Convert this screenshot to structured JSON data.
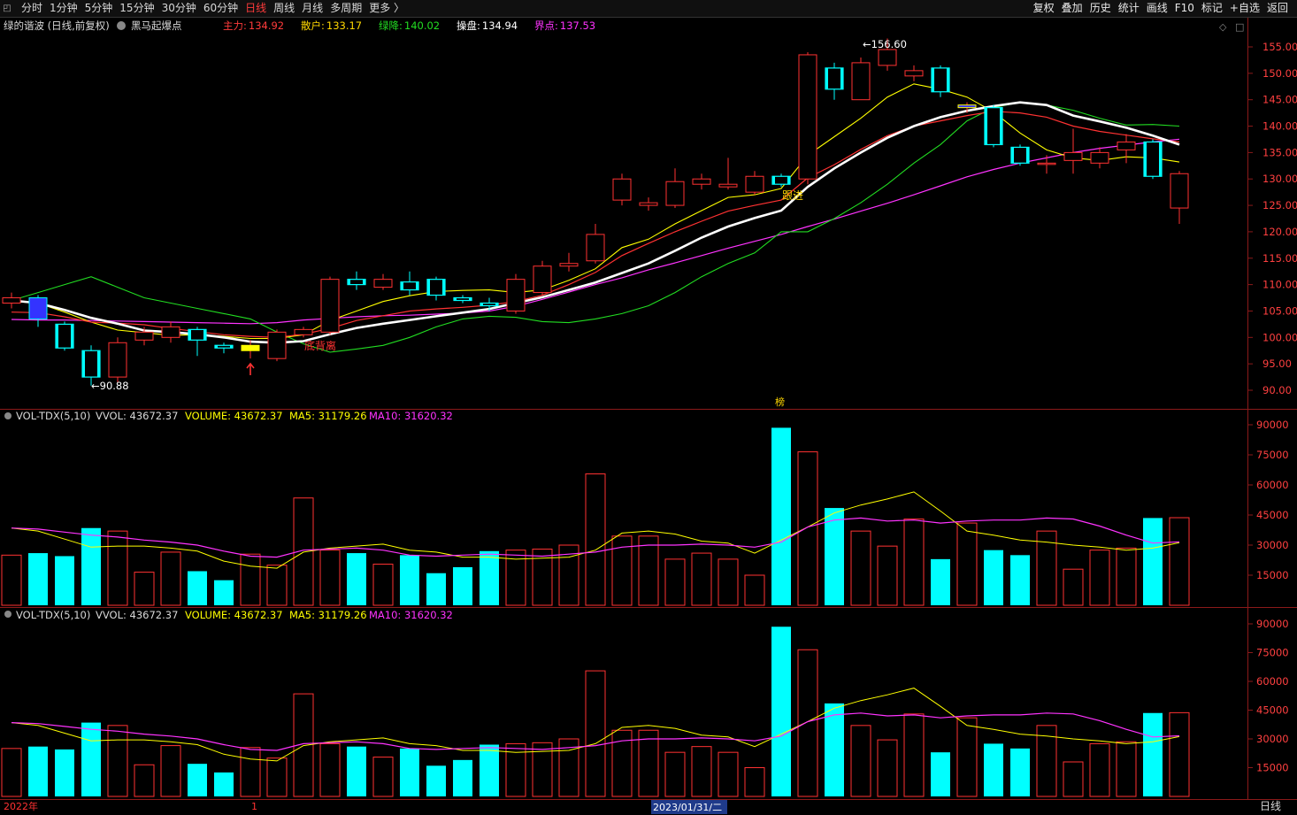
{
  "toolbar": {
    "periods": [
      "分时",
      "1分钟",
      "5分钟",
      "15分钟",
      "30分钟",
      "60分钟",
      "日线",
      "周线",
      "月线",
      "多周期",
      "更多 〉"
    ],
    "active_index": 6,
    "right_buttons": [
      "复权",
      "叠加",
      "历史",
      "统计",
      "画线",
      "F10",
      "标记",
      "+自选",
      "返回"
    ]
  },
  "main_header": {
    "title": "绿的谐波 (日线,前复权)",
    "indicator": "黑马起爆点",
    "values": [
      {
        "label": "主力:",
        "value": "134.92",
        "color": "#ff3b3b"
      },
      {
        "label": "散户:",
        "value": "133.17",
        "color": "#ffd700"
      },
      {
        "label": "绿降:",
        "value": "140.02",
        "color": "#22dd22"
      },
      {
        "label": "操盘:",
        "value": "134.94",
        "color": "#ffffff"
      },
      {
        "label": "界点:",
        "value": "137.53",
        "color": "#ff33ff"
      }
    ]
  },
  "vol_header": {
    "name": "VOL-TDX(5,10)",
    "vvol": "VVOL: 43672.37",
    "volume": "VOLUME: 43672.37",
    "ma5": "MA5: 31179.26",
    "ma10": "MA10: 31620.32"
  },
  "colors": {
    "up": "#ff3232",
    "down": "#00ffff",
    "ma_white": "#ffffff",
    "ma_red": "#ff3232",
    "ma_yellow": "#ffff00",
    "ma_green": "#22dd22",
    "ma_magenta": "#ff33ff"
  },
  "annotations": {
    "high": "156.60",
    "low": "90.88",
    "signal1": "底背离",
    "signal2": "跟进",
    "bang": "榜"
  },
  "price_axis": [
    "155.00",
    "150.00",
    "145.00",
    "140.00",
    "135.00",
    "130.00",
    "125.00",
    "120.00",
    "115.00",
    "110.00",
    "105.00",
    "100.00",
    "95.00",
    "90.00"
  ],
  "vol_axis": [
    "90000",
    "75000",
    "60000",
    "45000",
    "30000",
    "15000"
  ],
  "bottom": {
    "year": "2022年",
    "marker": "1",
    "date": "2023/01/31/二",
    "period": "日线"
  },
  "chart_data": {
    "type": "candlestick",
    "price_ylim": [
      88,
      158
    ],
    "vol_ylim": [
      0,
      92000
    ],
    "candles": [
      [
        106.5,
        107.5,
        108.5,
        105.5
      ],
      [
        107.5,
        103.5,
        108.0,
        102.0
      ],
      [
        102.5,
        98.0,
        103.0,
        97.5
      ],
      [
        97.5,
        92.5,
        98.5,
        90.88
      ],
      [
        92.5,
        99.0,
        100.0,
        91.5
      ],
      [
        99.5,
        101.0,
        102.0,
        98.5
      ],
      [
        100.0,
        102.0,
        103.0,
        99.0
      ],
      [
        101.5,
        99.5,
        102.0,
        96.5
      ],
      [
        98.5,
        98.0,
        99.0,
        97.0
      ],
      [
        97.5,
        98.5,
        99.5,
        96.0
      ],
      [
        96.0,
        101.0,
        101.5,
        95.5
      ],
      [
        100.5,
        101.5,
        102.0,
        100.0
      ],
      [
        101.0,
        111.0,
        111.5,
        100.5
      ],
      [
        111.0,
        110.0,
        112.5,
        109.0
      ],
      [
        109.5,
        111.0,
        112.0,
        109.0
      ],
      [
        110.5,
        109.0,
        112.5,
        108.0
      ],
      [
        111.0,
        108.0,
        111.5,
        107.0
      ],
      [
        107.5,
        107.0,
        108.0,
        106.5
      ],
      [
        106.5,
        106.0,
        107.5,
        105.0
      ],
      [
        105.0,
        111.0,
        112.0,
        104.5
      ],
      [
        108.5,
        113.5,
        114.5,
        108.0
      ],
      [
        113.5,
        114.0,
        116.0,
        112.5
      ],
      [
        114.5,
        119.5,
        121.5,
        114.0
      ],
      [
        126.0,
        130.0,
        131.0,
        125.0
      ],
      [
        125.0,
        125.5,
        126.5,
        124.0
      ],
      [
        125.0,
        129.5,
        132.0,
        124.5
      ],
      [
        129.0,
        130.0,
        131.0,
        128.0
      ],
      [
        128.5,
        129.0,
        134.0,
        128.0
      ],
      [
        127.5,
        130.5,
        131.5,
        127.0
      ],
      [
        130.5,
        129.0,
        131.0,
        128.5
      ],
      [
        130.0,
        153.5,
        154.0,
        129.0
      ],
      [
        151.0,
        147.0,
        152.0,
        145.0
      ],
      [
        145.0,
        152.0,
        153.0,
        145.0
      ],
      [
        151.5,
        154.5,
        156.6,
        150.5
      ],
      [
        149.5,
        150.5,
        151.5,
        148.5
      ],
      [
        151.0,
        146.5,
        151.5,
        145.5
      ],
      [
        143.5,
        144.0,
        144.5,
        142.5
      ],
      [
        143.5,
        136.5,
        144.0,
        136.0
      ],
      [
        136.0,
        133.0,
        136.5,
        132.5
      ],
      [
        133.0,
        133.0,
        134.5,
        131.0
      ],
      [
        133.5,
        135.0,
        139.5,
        131.0
      ],
      [
        133.0,
        135.0,
        136.0,
        132.0
      ],
      [
        135.5,
        137.0,
        138.5,
        133.0
      ],
      [
        137.0,
        130.5,
        137.5,
        130.0
      ],
      [
        124.5,
        131.0,
        131.5,
        121.5
      ]
    ],
    "volume": [
      25000,
      26000,
      24500,
      38500,
      37000,
      16500,
      26500,
      17000,
      12500,
      25500,
      20000,
      53500,
      27500,
      26000,
      20500,
      25000,
      16000,
      19000,
      27000,
      27500,
      28000,
      30000,
      65500,
      34500,
      34500,
      23000,
      26000,
      23000,
      15000,
      88500,
      76500,
      48500,
      37000,
      29500,
      43000,
      23000,
      41000,
      27500,
      25000,
      37000,
      18000,
      27500,
      28500,
      43500,
      43672
    ],
    "ma_white": [
      107.0,
      106.5,
      105.2,
      103.7,
      102.6,
      101.3,
      101.0,
      100.6,
      100.0,
      99.2,
      99.0,
      99.3,
      100.6,
      101.8,
      102.6,
      103.3,
      104.0,
      104.7,
      105.4,
      106.5,
      107.6,
      109.0,
      110.4,
      112.2,
      114.0,
      116.4,
      118.9,
      121.0,
      122.6,
      124.0,
      128.5,
      132.0,
      135.0,
      137.8,
      140.0,
      141.7,
      142.9,
      143.8,
      144.5,
      144.0,
      142.0,
      140.9,
      139.7,
      138.2,
      136.5
    ],
    "ma_red": [
      104.8,
      104.7,
      103.9,
      102.9,
      102.7,
      102.4,
      101.7,
      101.1,
      100.5,
      100.2,
      100.0,
      100.6,
      101.7,
      103.2,
      104.1,
      105.0,
      105.4,
      105.7,
      106.1,
      106.8,
      108.0,
      110.0,
      112.3,
      115.5,
      117.8,
      120.0,
      122.0,
      123.9,
      125.0,
      126.0,
      130.2,
      132.7,
      135.6,
      138.2,
      140.0,
      141.0,
      142.0,
      142.8,
      142.5,
      141.7,
      140.0,
      139.0,
      138.3,
      137.6,
      137.0
    ],
    "ma_yellow": [
      106.8,
      106.5,
      104.8,
      102.9,
      101.4,
      100.9,
      100.4,
      100.5,
      100.2,
      99.8,
      99.8,
      100.5,
      103.2,
      105.0,
      106.8,
      107.9,
      108.7,
      108.9,
      109.0,
      108.5,
      109.0,
      110.8,
      113.0,
      117.0,
      118.6,
      121.5,
      124.0,
      126.5,
      127.0,
      128.2,
      134.5,
      138.0,
      141.5,
      145.5,
      148.0,
      147.0,
      145.5,
      142.7,
      138.7,
      135.5,
      134.0,
      133.5,
      134.2,
      134.0,
      133.2
    ],
    "ma_green": [
      107.0,
      108.5,
      110.0,
      111.5,
      109.5,
      107.5,
      106.5,
      105.5,
      104.5,
      103.5,
      101.0,
      98.8,
      97.2,
      97.8,
      98.5,
      100.0,
      102.0,
      103.5,
      104.0,
      103.8,
      103.0,
      102.8,
      103.5,
      104.5,
      106.0,
      108.5,
      111.5,
      114.0,
      116.0,
      120.0,
      120.0,
      122.5,
      125.5,
      129.0,
      133.0,
      136.5,
      141.0,
      143.5,
      144.5,
      144.0,
      143.0,
      141.5,
      140.2,
      140.3,
      140.0
    ],
    "ma_magenta": [
      103.4,
      103.3,
      103.3,
      103.2,
      103.1,
      103.0,
      102.9,
      102.8,
      102.7,
      102.6,
      102.8,
      103.3,
      103.6,
      103.9,
      104.1,
      104.2,
      104.4,
      104.6,
      105.0,
      105.9,
      107.2,
      108.6,
      110.0,
      111.3,
      112.8,
      114.1,
      115.5,
      116.9,
      118.2,
      119.5,
      121.0,
      122.4,
      123.9,
      125.4,
      127.0,
      128.7,
      130.4,
      131.8,
      133.0,
      134.0,
      135.0,
      135.8,
      136.4,
      137.0,
      137.53
    ],
    "vol_ma5": [
      38500,
      37000,
      33000,
      29000,
      29500,
      29500,
      28500,
      27000,
      22000,
      19500,
      18500,
      26500,
      28500,
      29500,
      30500,
      27500,
      26500,
      24000,
      24000,
      23000,
      23500,
      24000,
      27500,
      36000,
      37000,
      35500,
      32000,
      31000,
      26000,
      32500,
      39000,
      46000,
      50000,
      53000,
      56500,
      47000,
      37000,
      35000,
      32500,
      31500,
      30000,
      29000,
      27500,
      28500,
      31179
    ],
    "vol_ma10": [
      38500,
      38000,
      36500,
      35000,
      34000,
      32500,
      31500,
      30000,
      27000,
      24500,
      24000,
      27500,
      28000,
      28500,
      27500,
      25000,
      24500,
      25000,
      25500,
      25000,
      24500,
      25500,
      26500,
      29000,
      30000,
      30000,
      30500,
      30000,
      29000,
      31500,
      39000,
      42500,
      43500,
      42000,
      42500,
      41000,
      42000,
      42500,
      42500,
      43500,
      43000,
      39500,
      35000,
      31000,
      31620
    ]
  }
}
